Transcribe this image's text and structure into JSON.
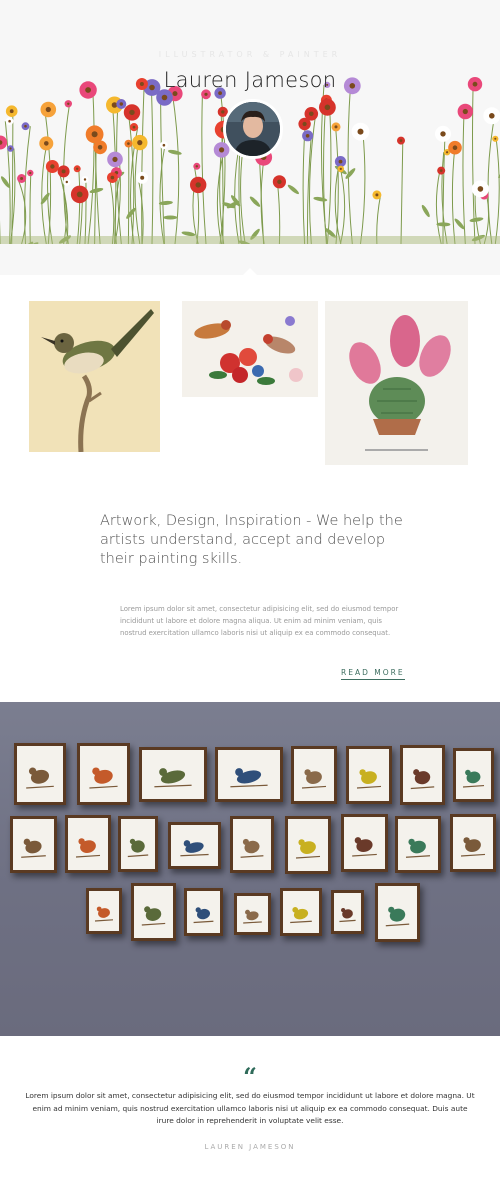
{
  "header": {
    "subtitle": "ILLUSTRATOR & PAINTER",
    "title": "Lauren Jameson"
  },
  "intro": {
    "headline": "Artwork, Design, Inspiration - We help the artists understand, accept and develop their painting skills.",
    "body": "Lorem ipsum dolor sit amet, consectetur adipisicing elit, sed do eiusmod tempor incididunt ut labore et dolore magna aliqua. Ut enim ad minim veniam, quis nostrud exercitation ullamco laboris nisi ut aliquip ex ea commodo consequat.",
    "read_more": "READ MORE"
  },
  "testimonial": {
    "quote_mark": "“",
    "text": "Lorem ipsum dolor sit amet, consectetur adipisicing elit, sed do eiusmod tempor incididunt ut labore et dolore magna. Ut enim ad minim veniam, quis nostrud exercitation ullamco laboris nisi ut aliquip ex ea commodo consequat. Duis aute irure dolor in reprehenderit in voluptate velit esse.",
    "author": "LAUREN JAMESON"
  },
  "colors": {
    "accent": "#2f6b5a",
    "header_bg": "#f7f7f7",
    "wall": "#6e7083"
  }
}
